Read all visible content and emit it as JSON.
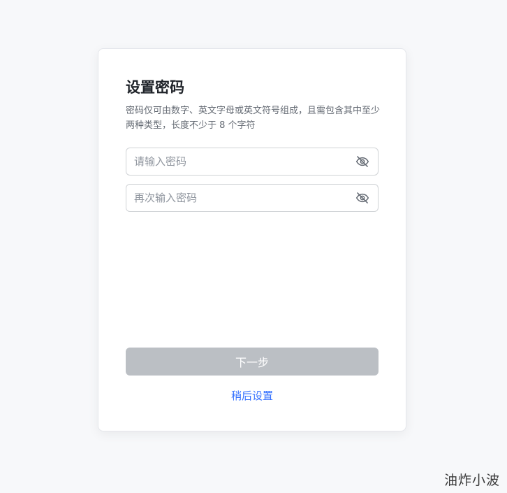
{
  "card": {
    "title": "设置密码",
    "description": "密码仅可由数字、英文字母或英文符号组成，且需包含其中至少两种类型，长度不少于 8 个字符"
  },
  "password_field": {
    "placeholder": "请输入密码",
    "value": "",
    "toggle_icon": "eye-off-icon"
  },
  "confirm_field": {
    "placeholder": "再次输入密码",
    "value": "",
    "toggle_icon": "eye-off-icon"
  },
  "actions": {
    "next_label": "下一步",
    "next_disabled": true,
    "later_label": "稍后设置"
  },
  "watermark": "油炸小波",
  "colors": {
    "page_background": "#f7f8fa",
    "button_disabled": "#bbbfc4",
    "link": "#3370ff",
    "title": "#1f2329",
    "description": "#646a73"
  }
}
